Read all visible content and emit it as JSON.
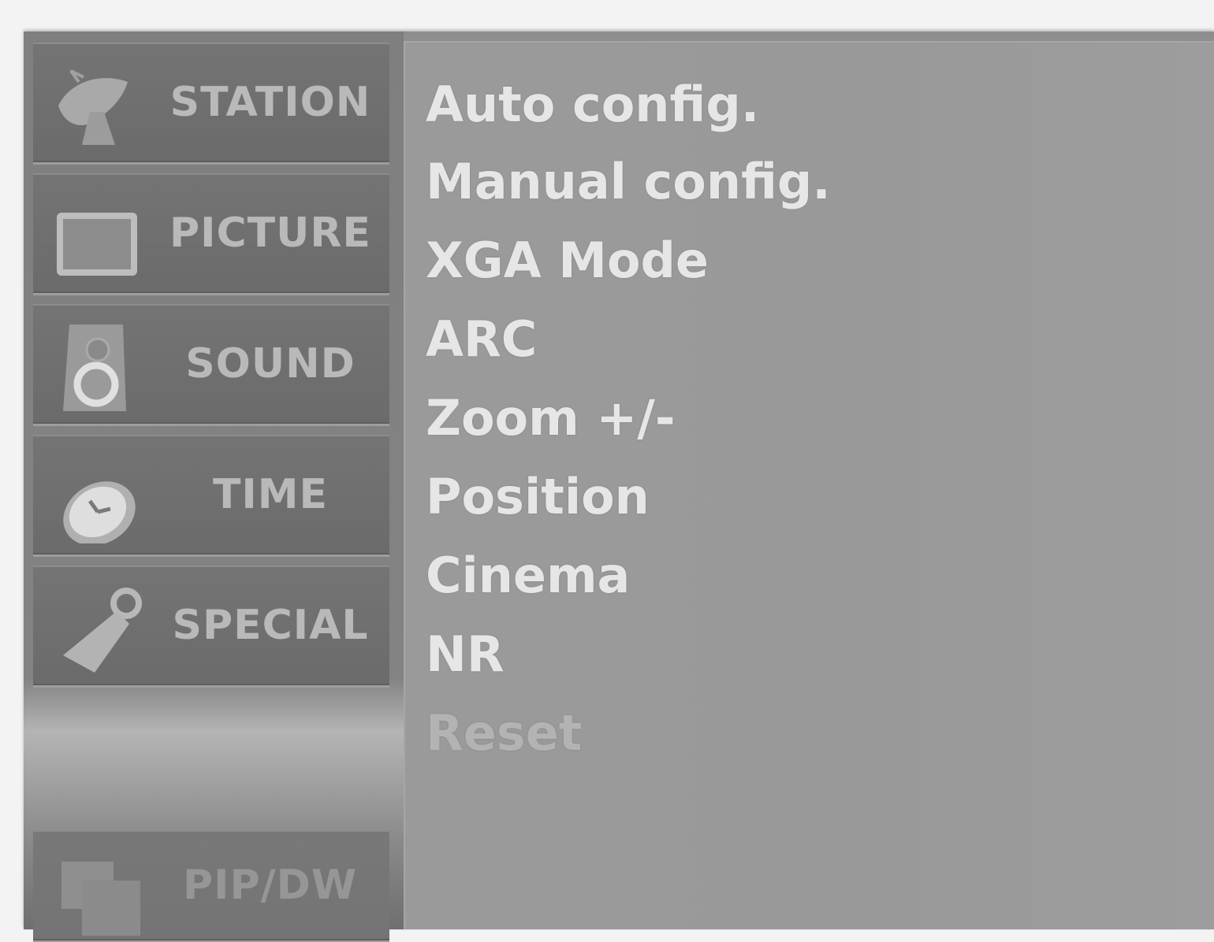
{
  "sidebar": {
    "items": [
      {
        "label": "STATION",
        "icon": "satellite-dish-icon"
      },
      {
        "label": "PICTURE",
        "icon": "tv-screen-icon"
      },
      {
        "label": "SOUND",
        "icon": "speaker-icon"
      },
      {
        "label": "TIME",
        "icon": "clock-icon"
      },
      {
        "label": "SPECIAL",
        "icon": "tag-icon"
      },
      {
        "label": "PIP/DW",
        "icon": "pip-windows-icon"
      }
    ]
  },
  "menu": {
    "items": [
      {
        "label": "Auto config.",
        "state": "enabled"
      },
      {
        "label": "Manual config.",
        "state": "enabled"
      },
      {
        "label": "XGA Mode",
        "state": "enabled"
      },
      {
        "label": "ARC",
        "state": "enabled"
      },
      {
        "label": "Zoom +/-",
        "state": "enabled"
      },
      {
        "label": "Position",
        "state": "enabled"
      },
      {
        "label": "Cinema",
        "state": "enabled"
      },
      {
        "label": "NR",
        "state": "enabled"
      },
      {
        "label": "Reset",
        "state": "disabled"
      }
    ]
  }
}
